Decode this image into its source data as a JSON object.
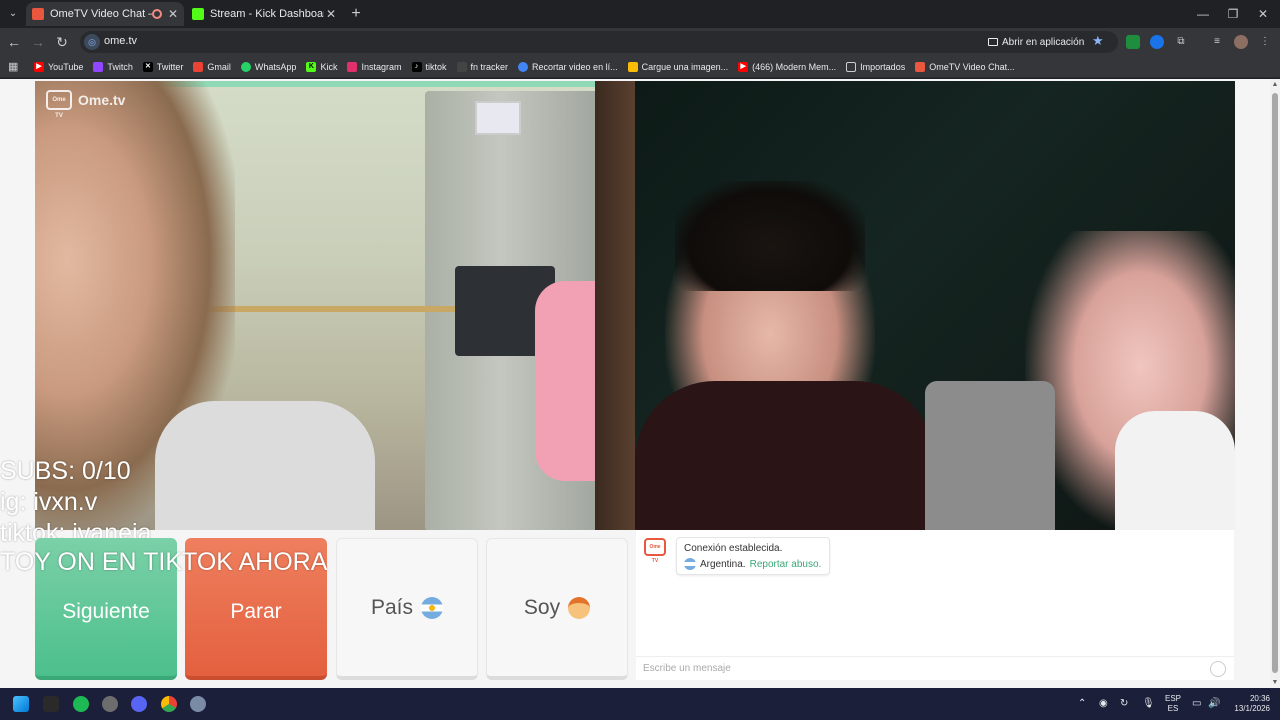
{
  "browser": {
    "tabs": [
      {
        "title": "OmeTV Video Chat — Ome",
        "active": true,
        "recording": true
      },
      {
        "title": "Stream - Kick Dashboard",
        "active": false
      }
    ],
    "new_tab_icon": "plus-icon",
    "window_controls": [
      "minimize",
      "restore",
      "close"
    ],
    "url": "ome.tv",
    "open_app_label": "Abrir en aplicación",
    "bookmarks": [
      {
        "label": "YouTube",
        "color": "#ff0000"
      },
      {
        "label": "Twitch",
        "color": "#9146ff"
      },
      {
        "label": "Twitter",
        "color": "#000000"
      },
      {
        "label": "Gmail",
        "color": "#ea4335"
      },
      {
        "label": "WhatsApp",
        "color": "#25d366"
      },
      {
        "label": "Kick",
        "color": "#53fc18"
      },
      {
        "label": "Instagram",
        "color": "#e1306c"
      },
      {
        "label": "tiktok",
        "color": "#000000"
      },
      {
        "label": "fn tracker",
        "color": "#444444"
      },
      {
        "label": "Recortar video en lí...",
        "color": "#4285f4"
      },
      {
        "label": "Cargue una imagen...",
        "color": "#fbbc05"
      },
      {
        "label": "(466) Modern Mem...",
        "color": "#ff0000"
      },
      {
        "label": "Importados",
        "color": "#c9cdd2"
      },
      {
        "label": "OmeTV Video Chat...",
        "color": "#e9573f"
      }
    ]
  },
  "page": {
    "logo_text": "Ome.tv",
    "logo_badge": "Ome TV",
    "overlay_lines": [
      "SUBS: 0/10",
      "ig: ivxn.v",
      "tiktok: ivaneja_",
      "TOY ON EN TIKTOK AHORA"
    ],
    "buttons": {
      "next": "Siguiente",
      "stop": "Parar",
      "country": "País",
      "gender": "Soy"
    },
    "chat": {
      "status": "Conexión establecida.",
      "country": "Argentina.",
      "report": "Reportar abuso.",
      "placeholder": "Escribe un mensaje"
    }
  },
  "taskbar": {
    "lang_top": "ESP",
    "lang_bottom": "ES",
    "time": "20:36",
    "date": "13/1/2026"
  },
  "colors": {
    "next_button": "#4cc08c",
    "stop_button": "#e4603f",
    "accent_green": "#3aa877"
  }
}
